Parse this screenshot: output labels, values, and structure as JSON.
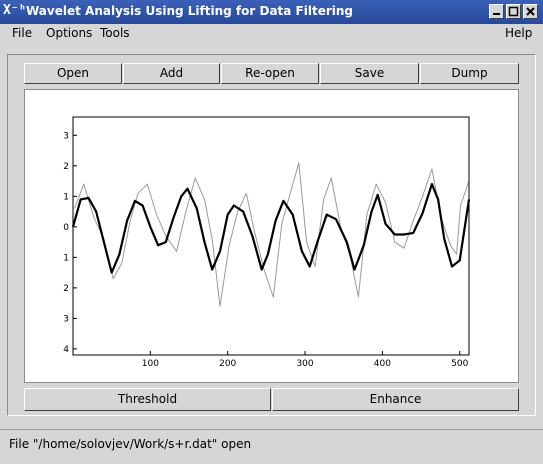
{
  "window": {
    "title": "Wavelet Analysis Using Lifting for Data Filtering",
    "app_icon": "X-logo-icon"
  },
  "menu": {
    "file": "File",
    "options": "Options",
    "tools": "Tools",
    "help": "Help"
  },
  "toolbar": {
    "open": "Open",
    "add": "Add",
    "reopen": "Re-open",
    "save": "Save",
    "dump": "Dump"
  },
  "bottom": {
    "threshold": "Threshold",
    "enhance": "Enhance"
  },
  "status": "File \"/home/solovjev/Work/s+r.dat\" open",
  "chart_data": {
    "type": "line",
    "xlim": [
      0,
      512
    ],
    "ylim": [
      -4.2,
      3.6
    ],
    "x_ticks": [
      100,
      200,
      300,
      400,
      500
    ],
    "x_tick_labels": [
      "100",
      "200",
      "300",
      "400",
      "500"
    ],
    "y_ticks": [
      3,
      2,
      1,
      0,
      -1,
      -2,
      -3,
      -4
    ],
    "y_tick_labels": [
      "3",
      "2",
      "1",
      "0",
      "1",
      "2",
      "3",
      "4"
    ],
    "series": [
      {
        "role": "noisy signal",
        "color": "#9a9a9a",
        "x": [
          2,
          14,
          27,
          40,
          52,
          63,
          74,
          84,
          96,
          108,
          120,
          134,
          146,
          158,
          170,
          180,
          190,
          202,
          213,
          224,
          235,
          247,
          259,
          270,
          282,
          292,
          302,
          313,
          324,
          334,
          346,
          358,
          369,
          380,
          392,
          404,
          416,
          428,
          440,
          452,
          464,
          476,
          488,
          496,
          501,
          512
        ],
        "y": [
          0.6,
          1.4,
          0.3,
          -0.4,
          -1.7,
          -1.2,
          0.2,
          1.1,
          1.4,
          0.4,
          -0.3,
          -0.8,
          0.5,
          1.6,
          0.9,
          -0.4,
          -2.6,
          -0.6,
          0.5,
          1.1,
          -0.2,
          -1.4,
          -2.3,
          0.1,
          1.2,
          2.1,
          -0.5,
          -1.3,
          0.9,
          1.6,
          0.0,
          -0.9,
          -2.3,
          0.4,
          1.4,
          0.8,
          -0.5,
          -0.7,
          0.2,
          1.0,
          1.9,
          0.3,
          -0.6,
          -0.9,
          0.7,
          1.5
        ]
      },
      {
        "role": "filtered signal",
        "color": "#000000",
        "x": [
          0,
          10,
          20,
          30,
          40,
          50,
          60,
          70,
          80,
          90,
          100,
          110,
          120,
          130,
          140,
          148,
          160,
          170,
          180,
          190,
          200,
          208,
          220,
          232,
          244,
          252,
          262,
          272,
          284,
          296,
          306,
          316,
          328,
          340,
          354,
          364,
          376,
          386,
          394,
          404,
          416,
          428,
          440,
          452,
          464,
          472,
          480,
          490,
          500,
          512
        ],
        "y": [
          0.0,
          0.9,
          0.95,
          0.5,
          -0.5,
          -1.5,
          -0.9,
          0.2,
          0.85,
          0.7,
          0.0,
          -0.6,
          -0.5,
          0.3,
          1.0,
          1.25,
          0.6,
          -0.5,
          -1.4,
          -0.8,
          0.4,
          0.7,
          0.5,
          -0.3,
          -1.4,
          -0.9,
          0.2,
          0.85,
          0.4,
          -0.8,
          -1.3,
          -0.5,
          0.4,
          0.25,
          -0.5,
          -1.4,
          -0.6,
          0.5,
          1.05,
          0.1,
          -0.25,
          -0.25,
          -0.2,
          0.45,
          1.4,
          0.9,
          -0.4,
          -1.3,
          -1.1,
          0.9
        ]
      }
    ]
  }
}
